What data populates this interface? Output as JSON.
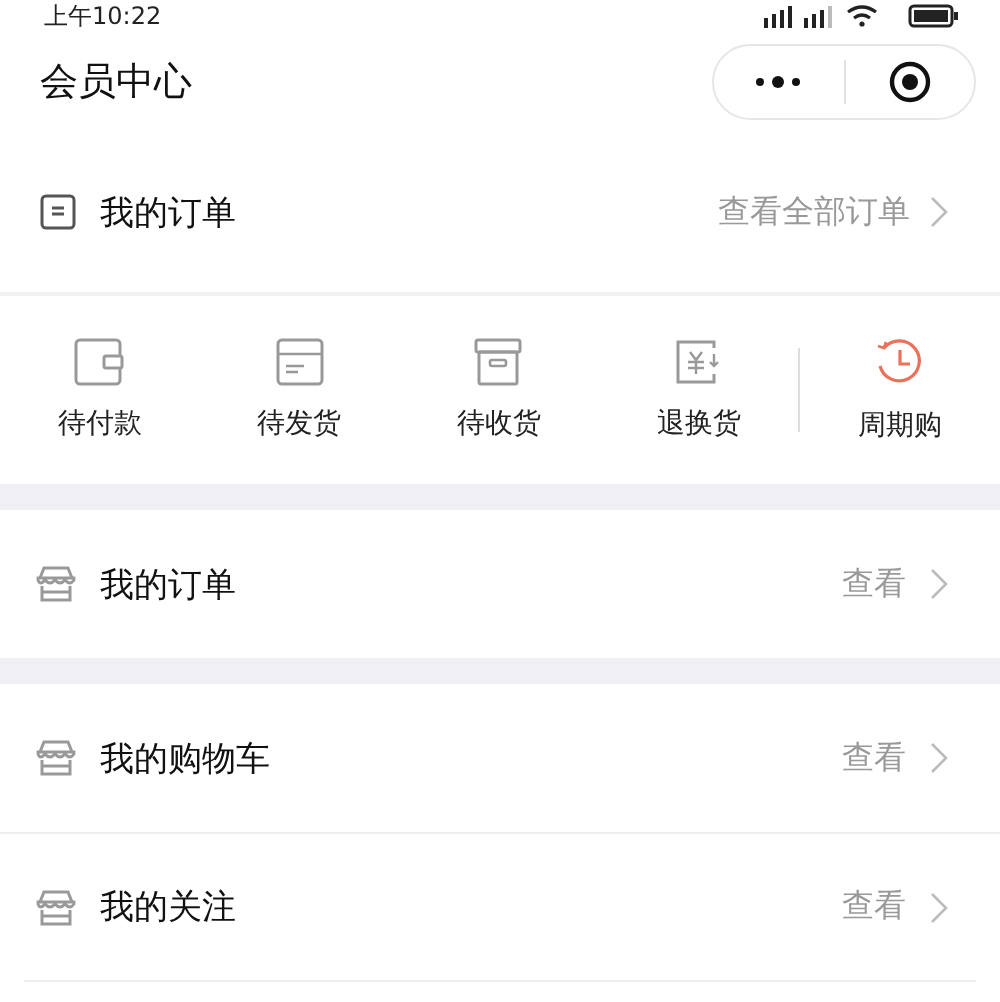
{
  "status_bar": {
    "time": "上午10:22"
  },
  "title": "会员中心",
  "orders": {
    "title": "我的订单",
    "link": "查看全部订单",
    "items": [
      {
        "kind": "wallet",
        "label": "待付款"
      },
      {
        "kind": "box",
        "label": "待发货"
      },
      {
        "kind": "archive",
        "label": "待收货"
      },
      {
        "kind": "refund",
        "label": "退换货"
      },
      {
        "kind": "cycle",
        "label": "周期购"
      }
    ]
  },
  "sections": [
    {
      "rows": [
        {
          "label": "我的订单",
          "action": "查看"
        }
      ]
    },
    {
      "rows": [
        {
          "label": "我的购物车",
          "action": "查看"
        },
        {
          "label": "我的关注",
          "action": "查看"
        }
      ]
    }
  ]
}
